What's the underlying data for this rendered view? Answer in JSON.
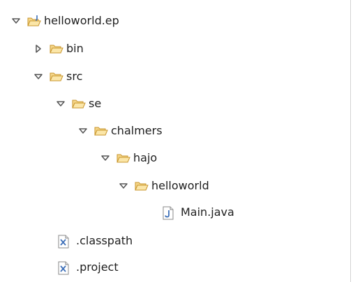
{
  "package_explorer": {
    "project": {
      "label": "helloworld.ep",
      "icon": "java-project-icon",
      "expanded": true
    },
    "bin": {
      "label": "bin",
      "icon": "folder-icon",
      "expanded": false
    },
    "src": {
      "label": "src",
      "icon": "folder-icon",
      "expanded": true
    },
    "se": {
      "label": "se",
      "icon": "folder-icon",
      "expanded": true
    },
    "chalmers": {
      "label": "chalmers",
      "icon": "folder-icon",
      "expanded": true
    },
    "hajo": {
      "label": "hajo",
      "icon": "folder-icon",
      "expanded": true
    },
    "helloworld": {
      "label": "helloworld",
      "icon": "folder-icon",
      "expanded": true
    },
    "main_java": {
      "label": "Main.java",
      "icon": "java-file-icon"
    },
    "classpath": {
      "label": ".classpath",
      "icon": "xml-file-icon"
    },
    "project_file": {
      "label": ".project",
      "icon": "xml-file-icon"
    }
  },
  "colors": {
    "folder_fill": "#f5d68a",
    "folder_stroke": "#c8952c",
    "java_file_accent": "#3d6fb8",
    "xml_file_accent": "#3d6fb8",
    "toggle": "#555555"
  }
}
